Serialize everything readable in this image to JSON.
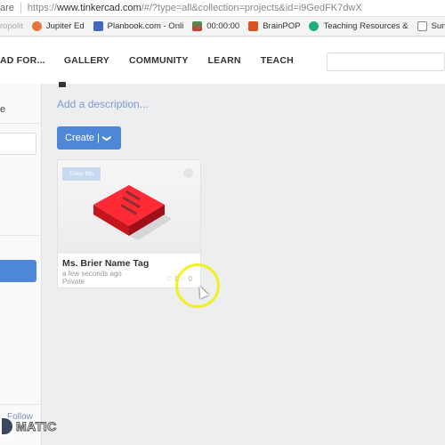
{
  "browser": {
    "secure_fragment": "are",
    "url_prefix": "https://",
    "url_host": "www.tinkercad.com",
    "url_rest": "/#/?type=all&collection=projects&id=i9GedFK7dwX",
    "bookmarks": [
      {
        "label": "ropolit",
        "icon": "site-icon",
        "color": "#ffffff"
      },
      {
        "label": "Jupiter Ed",
        "icon": "jupiter-icon",
        "color": "#e8743b"
      },
      {
        "label": "Planbook.com - Onli",
        "icon": "planbook-icon",
        "color": "#4466bb"
      },
      {
        "label": "00:00:00",
        "icon": "timer-icon",
        "color": "#3b9c5a"
      },
      {
        "label": "BrainPOP",
        "icon": "brainpop-icon",
        "color": "#d9531e"
      },
      {
        "label": "Teaching Resources &",
        "icon": "teaching-icon",
        "color": "#1fae7a"
      },
      {
        "label": "SunGard P",
        "icon": "page-icon",
        "color": "#ffffff"
      }
    ]
  },
  "nav": {
    "items": [
      "AD FOR...",
      "GALLERY",
      "COMMUNITY",
      "LEARN",
      "TEACH"
    ],
    "search_placeholder": ""
  },
  "sidebar": {
    "fragment": "e",
    "follow_label": "Follow"
  },
  "main": {
    "description_placeholder": "Add a description...",
    "create_label": "Create |",
    "create_chevron": "❯"
  },
  "project": {
    "tinker_label": "Tinker this",
    "title": "Ms. Brier Name Tag",
    "time": "a few seconds ago",
    "visibility": "Private",
    "likes": "0",
    "comments": "0",
    "model_color": "#e0242c"
  },
  "watermark": {
    "text": "MATIC"
  }
}
